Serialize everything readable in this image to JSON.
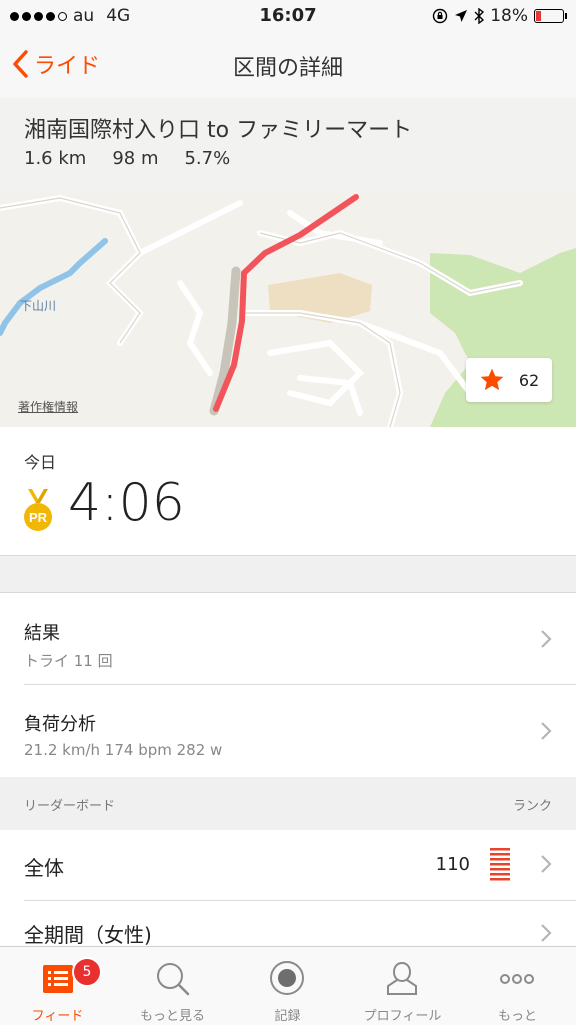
{
  "status": {
    "carrier": "au",
    "network": "4G",
    "time": "16:07",
    "battery": "18%"
  },
  "nav": {
    "back_label": "ライド",
    "title": "区間の詳細"
  },
  "segment": {
    "name": "湘南国際村入り口 to ファミリーマート",
    "distance": "1.6 km",
    "elevation": "98 m",
    "grade": "5.7%"
  },
  "map": {
    "river_label": "下山川",
    "copyright": "著作権情報",
    "star_count": "62"
  },
  "today": {
    "label": "今日",
    "pr_badge": "PR",
    "time": "4:06"
  },
  "results": {
    "title": "結果",
    "subtitle": "トライ 11 回"
  },
  "analysis": {
    "title": "負荷分析",
    "subtitle": "21.2 km/h 174 bpm 282 w"
  },
  "leaderboard": {
    "header": "リーダーボード",
    "rank_header": "ランク",
    "rows": [
      {
        "label": "全体",
        "rank": "110"
      },
      {
        "label": "全期間（女性)"
      }
    ]
  },
  "tabbar": {
    "tabs": [
      {
        "label": "フィード",
        "badge": "5"
      },
      {
        "label": "もっと見る"
      },
      {
        "label": "記録"
      },
      {
        "label": "プロフィール"
      },
      {
        "label": "もっと"
      }
    ]
  },
  "colors": {
    "accent": "#fc4c02",
    "route": "#f2545b",
    "pr_gold": "#f2b705"
  }
}
